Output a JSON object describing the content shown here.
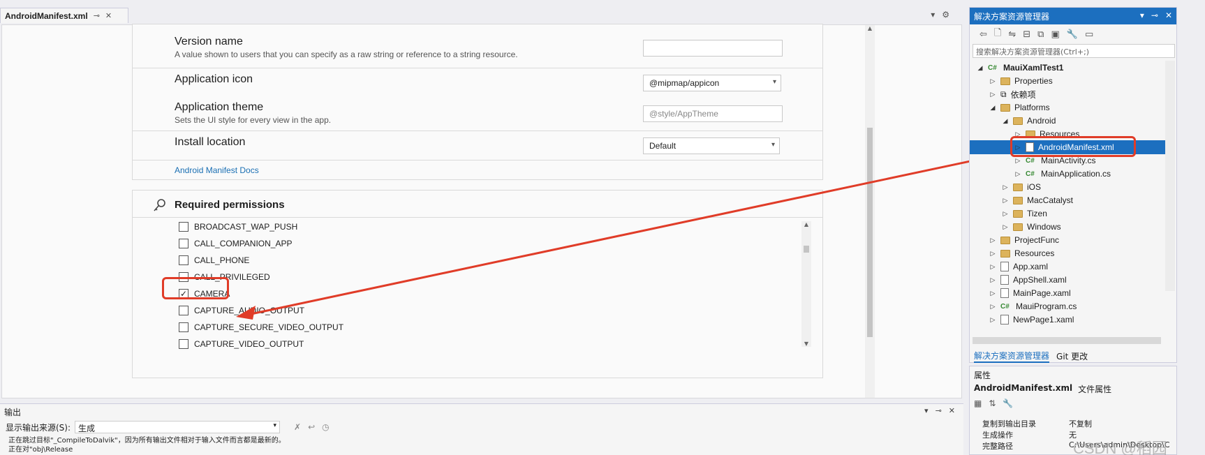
{
  "editor": {
    "tab_title": "AndroidManifest.xml",
    "tab_pin": "⊸",
    "tab_close": "✕",
    "tools_dropdown": "▾",
    "tools_gear": "⚙"
  },
  "app_section": {
    "version_name": {
      "title": "Version name",
      "desc": "A value shown to users that you can specify as a raw string or reference to a string resource.",
      "value": ""
    },
    "app_icon": {
      "title": "Application icon",
      "value": "@mipmap/appicon"
    },
    "app_theme": {
      "title": "Application theme",
      "desc": "Sets the UI style for every view in the app.",
      "placeholder": "@style/AppTheme"
    },
    "install_location": {
      "title": "Install location",
      "value": "Default"
    },
    "docs_link": "Android Manifest Docs"
  },
  "permissions": {
    "title": "Required permissions",
    "items": [
      {
        "label": "BROADCAST_WAP_PUSH",
        "checked": false
      },
      {
        "label": "CALL_COMPANION_APP",
        "checked": false
      },
      {
        "label": "CALL_PHONE",
        "checked": false
      },
      {
        "label": "CALL_PRIVILEGED",
        "checked": false
      },
      {
        "label": "CAMERA",
        "checked": true
      },
      {
        "label": "CAPTURE_AUDIO_OUTPUT",
        "checked": false
      },
      {
        "label": "CAPTURE_SECURE_VIDEO_OUTPUT",
        "checked": false
      },
      {
        "label": "CAPTURE_VIDEO_OUTPUT",
        "checked": false
      }
    ],
    "check_mark": "✓"
  },
  "solution_explorer": {
    "title": "解决方案资源管理器",
    "controls": [
      "▾",
      "⊸",
      "✕"
    ],
    "search_placeholder": "搜索解决方案资源管理器(Ctrl+;)",
    "tree": [
      {
        "label": "MauiXamlTest1",
        "type": "cs-project",
        "depth": 0,
        "expanded": true,
        "bold": true
      },
      {
        "label": "Properties",
        "type": "folder",
        "depth": 1
      },
      {
        "label": "依赖项",
        "type": "deps",
        "depth": 1
      },
      {
        "label": "Platforms",
        "type": "folder",
        "depth": 1,
        "expanded": true
      },
      {
        "label": "Android",
        "type": "folder",
        "depth": 2,
        "expanded": true
      },
      {
        "label": "Resources",
        "type": "folder",
        "depth": 3
      },
      {
        "label": "AndroidManifest.xml",
        "type": "file",
        "depth": 3,
        "selected": true
      },
      {
        "label": "MainActivity.cs",
        "type": "cs",
        "depth": 3
      },
      {
        "label": "MainApplication.cs",
        "type": "cs",
        "depth": 3
      },
      {
        "label": "iOS",
        "type": "folder",
        "depth": 2
      },
      {
        "label": "MacCatalyst",
        "type": "folder",
        "depth": 2
      },
      {
        "label": "Tizen",
        "type": "folder",
        "depth": 2
      },
      {
        "label": "Windows",
        "type": "folder",
        "depth": 2
      },
      {
        "label": "ProjectFunc",
        "type": "folder",
        "depth": 1
      },
      {
        "label": "Resources",
        "type": "folder",
        "depth": 1
      },
      {
        "label": "App.xaml",
        "type": "file",
        "depth": 1
      },
      {
        "label": "AppShell.xaml",
        "type": "file",
        "depth": 1
      },
      {
        "label": "MainPage.xaml",
        "type": "file",
        "depth": 1
      },
      {
        "label": "MauiProgram.cs",
        "type": "cs",
        "depth": 1
      },
      {
        "label": "NewPage1.xaml",
        "type": "file",
        "depth": 1
      }
    ],
    "bottom_tabs": [
      "解决方案资源管理器",
      "Git 更改"
    ]
  },
  "properties": {
    "title": "属性",
    "object_name": "AndroidManifest.xml",
    "object_type": "文件属性",
    "rows": [
      {
        "name": "复制到输出目录",
        "value": "不复制"
      },
      {
        "name": "生成操作",
        "value": "无"
      },
      {
        "name": "完整路径",
        "value": "C:\\Users\\admin\\Desktop\\C"
      }
    ]
  },
  "output": {
    "title": "输出",
    "source_label": "显示输出来源(S):",
    "source_value": "生成",
    "lines": [
      "正在跳过目标\"_CompileToDalvik\"，因为所有输出文件相对于输入文件而言都是最新的。",
      "正在对\"obj\\Release"
    ]
  },
  "watermark": "CSDN @稻园",
  "colors": {
    "accent": "#1c6fbf",
    "highlight": "#e03c28",
    "link": "#1a6fb3"
  }
}
